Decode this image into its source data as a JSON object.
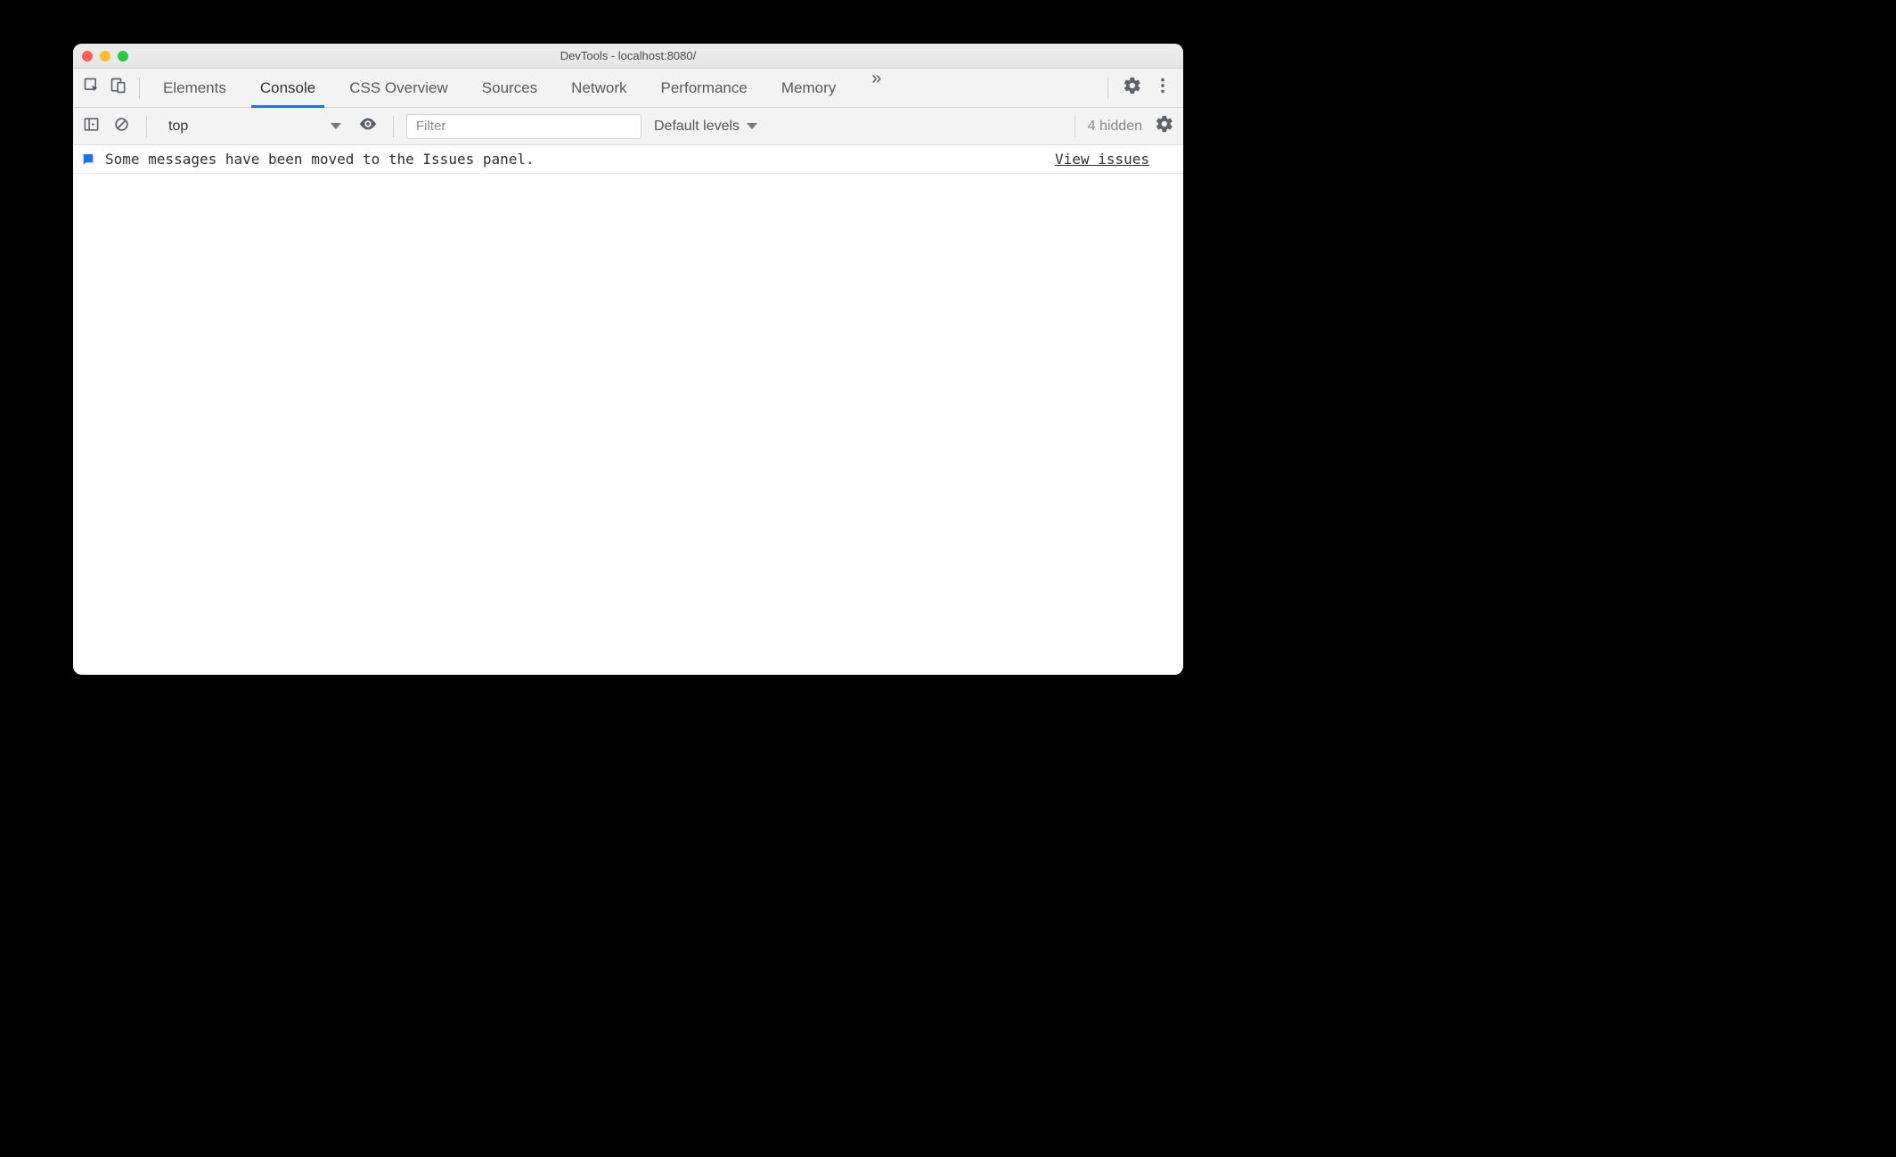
{
  "window": {
    "title": "DevTools - localhost:8080/"
  },
  "tabs": {
    "items": [
      {
        "label": "Elements"
      },
      {
        "label": "Console"
      },
      {
        "label": "CSS Overview"
      },
      {
        "label": "Sources"
      },
      {
        "label": "Network"
      },
      {
        "label": "Performance"
      },
      {
        "label": "Memory"
      }
    ],
    "active_index": 1,
    "more_glyph": "»"
  },
  "console_toolbar": {
    "context": "top",
    "filter_placeholder": "Filter",
    "levels_label": "Default levels",
    "hidden_label": "4 hidden"
  },
  "issues_row": {
    "message": "Some messages have been moved to the Issues panel.",
    "link": "View issues"
  }
}
